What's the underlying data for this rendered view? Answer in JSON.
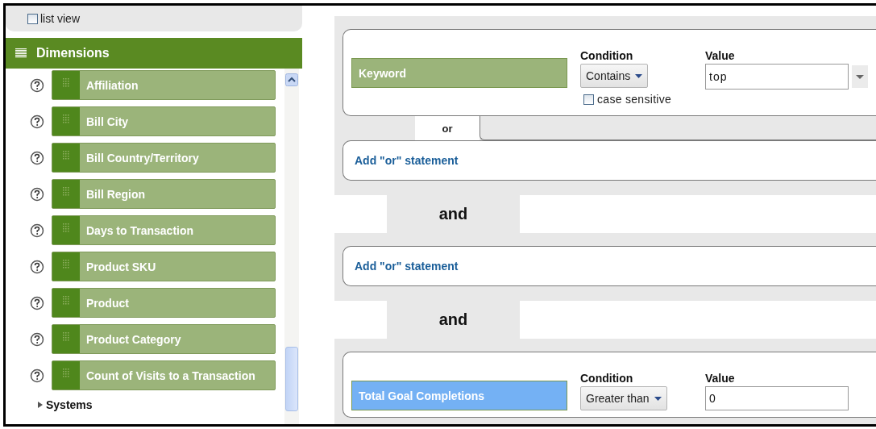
{
  "list_view": {
    "label": "list view",
    "checked": false
  },
  "dimensions": {
    "title": "Dimensions",
    "items": [
      {
        "label": "Affiliation"
      },
      {
        "label": "Bill City"
      },
      {
        "label": "Bill Country/Territory"
      },
      {
        "label": "Bill Region"
      },
      {
        "label": "Days to Transaction"
      },
      {
        "label": "Product SKU"
      },
      {
        "label": "Product"
      },
      {
        "label": "Product Category"
      },
      {
        "label": "Count of Visits to a Transaction"
      }
    ],
    "next_group": "Systems"
  },
  "groups": [
    {
      "kind": "condition",
      "dimension": {
        "label": "Keyword",
        "color": "#9bb47a"
      },
      "condition_label": "Condition",
      "condition": "Contains",
      "value_label": "Value",
      "value": "top",
      "value_has_menu": true,
      "case_sensitive": {
        "label": "case sensitive",
        "checked": false
      },
      "or_label": "or",
      "add_or": "Add \"or\" statement"
    },
    {
      "kind": "empty",
      "joiner": "and",
      "add_or": "Add \"or\" statement"
    },
    {
      "kind": "condition",
      "joiner": "and",
      "dimension": {
        "label": "Total Goal Completions",
        "color": "#74b1f4"
      },
      "condition_label": "Condition",
      "condition": "Greater than",
      "value_label": "Value",
      "value": "0",
      "value_has_menu": false
    }
  ]
}
